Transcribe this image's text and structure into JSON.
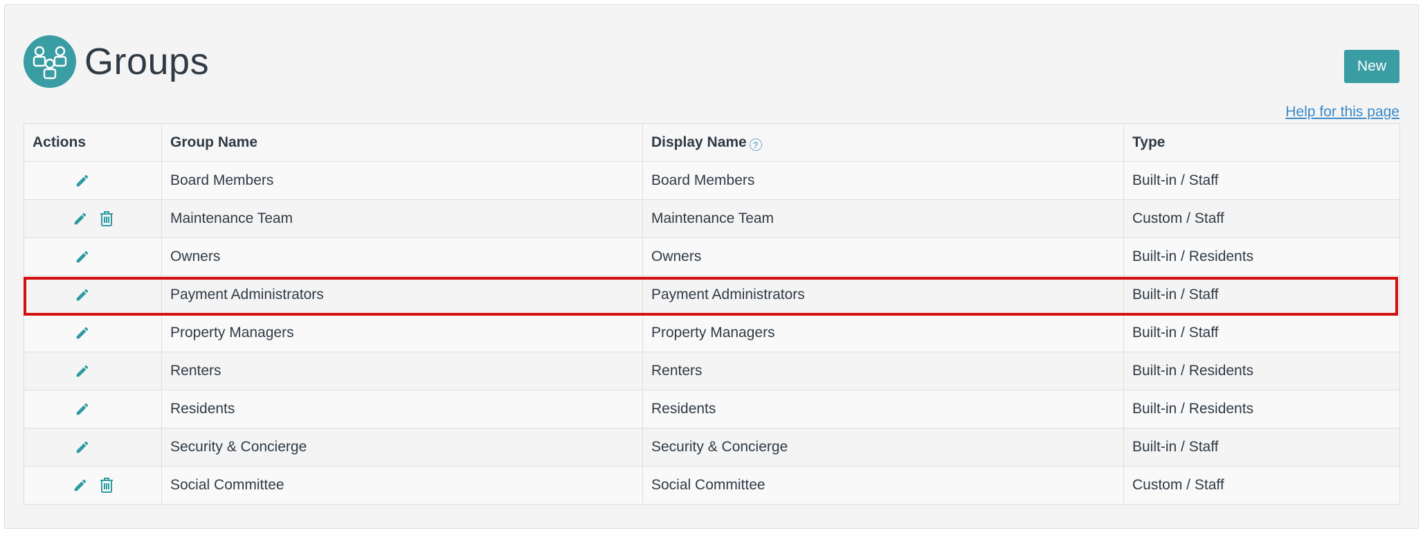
{
  "page": {
    "title": "Groups",
    "new_button": "New",
    "help_link": "Help for this page"
  },
  "colors": {
    "accent": "#3a9da3",
    "highlight": "#d40f0f",
    "link": "#3a88c8"
  },
  "table": {
    "headers": {
      "actions": "Actions",
      "group_name": "Group Name",
      "display_name": "Display Name",
      "type": "Type"
    },
    "rows": [
      {
        "group_name": "Board Members",
        "display_name": "Board Members",
        "type": "Built-in / Staff",
        "actions": [
          "edit-icon"
        ]
      },
      {
        "group_name": "Maintenance Team",
        "display_name": "Maintenance Team",
        "type": "Custom / Staff",
        "actions": [
          "edit-icon",
          "trash-icon"
        ]
      },
      {
        "group_name": "Owners",
        "display_name": "Owners",
        "type": "Built-in / Residents",
        "actions": [
          "edit-icon"
        ]
      },
      {
        "group_name": "Payment Administrators",
        "display_name": "Payment Administrators",
        "type": "Built-in / Staff",
        "actions": [
          "edit-icon"
        ],
        "highlighted": true
      },
      {
        "group_name": "Property Managers",
        "display_name": "Property Managers",
        "type": "Built-in / Staff",
        "actions": [
          "edit-icon"
        ]
      },
      {
        "group_name": "Renters",
        "display_name": "Renters",
        "type": "Built-in / Residents",
        "actions": [
          "edit-icon"
        ]
      },
      {
        "group_name": "Residents",
        "display_name": "Residents",
        "type": "Built-in / Residents",
        "actions": [
          "edit-icon"
        ]
      },
      {
        "group_name": "Security & Concierge",
        "display_name": "Security & Concierge",
        "type": "Built-in / Staff",
        "actions": [
          "edit-icon"
        ]
      },
      {
        "group_name": "Social Committee",
        "display_name": "Social Committee",
        "type": "Custom / Staff",
        "actions": [
          "edit-icon",
          "trash-icon"
        ]
      }
    ]
  }
}
